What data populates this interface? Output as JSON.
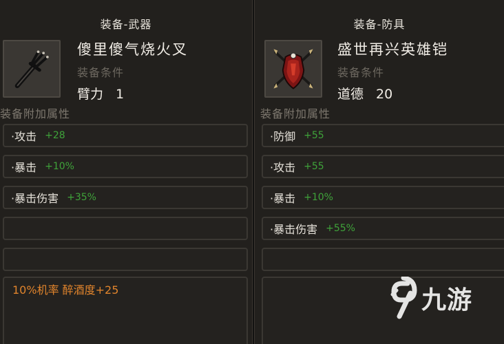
{
  "left": {
    "category_title": "装备-武器",
    "item_name": "傻里傻气烧火叉",
    "icon": "pitchfork-icon",
    "requirement_label": "装备条件",
    "requirement_stat": "臂力",
    "requirement_value": "1",
    "attr_header": "装备附加属性",
    "stats": [
      {
        "name": "·攻击",
        "value": "+28"
      },
      {
        "name": "·暴击",
        "value": "+10%"
      },
      {
        "name": "·暴击伤害",
        "value": "+35%"
      }
    ],
    "bonus_text": "10%机率 醉酒度+25"
  },
  "right": {
    "category_title": "装备-防具",
    "item_name": "盛世再兴英雄铠",
    "icon": "armor-icon",
    "requirement_label": "装备条件",
    "requirement_stat": "道德",
    "requirement_value": "20",
    "attr_header": "装备附加属性",
    "stats": [
      {
        "name": "·防御",
        "value": "+55"
      },
      {
        "name": "·攻击",
        "value": "+55"
      },
      {
        "name": "·暴击",
        "value": "+10%"
      },
      {
        "name": "·暴击伤害",
        "value": "+55%"
      }
    ]
  },
  "watermark": {
    "text": "九游",
    "icon": "9game-logo-icon"
  },
  "colors": {
    "background": "#22201d",
    "text": "#f1ede6",
    "muted": "#6d6860",
    "stat_value": "#3fa33a",
    "bonus": "#e0842c",
    "border": "#3b3833"
  }
}
